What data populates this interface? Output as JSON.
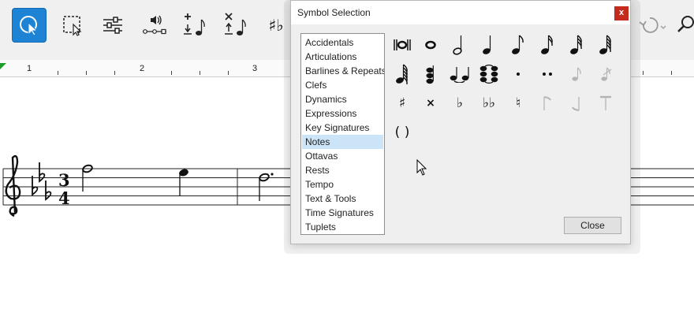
{
  "dialog": {
    "title": "Symbol Selection",
    "close_x": "x",
    "close_label": "Close",
    "selected_category": "Notes",
    "categories": [
      "Accidentals",
      "Articulations",
      "Barlines & Repeats",
      "Clefs",
      "Dynamics",
      "Expressions",
      "Key Signatures",
      "Notes",
      "Ottavas",
      "Rests",
      "Tempo",
      "Text & Tools",
      "Time Signatures",
      "Tuplets"
    ],
    "symbols": [
      {
        "name": "breve",
        "enabled": true
      },
      {
        "name": "whole-note",
        "enabled": true
      },
      {
        "name": "half-note",
        "enabled": true
      },
      {
        "name": "quarter-note",
        "enabled": true
      },
      {
        "name": "eighth-note",
        "enabled": true
      },
      {
        "name": "sixteenth-note",
        "enabled": true
      },
      {
        "name": "thirty-second-note",
        "enabled": true
      },
      {
        "name": "sixty-fourth-note",
        "enabled": true
      },
      {
        "name": "hundred-twenty-eighth-note",
        "enabled": true
      },
      {
        "name": "chord-notes",
        "enabled": true
      },
      {
        "name": "tie",
        "enabled": true
      },
      {
        "name": "tied-chord",
        "enabled": true
      },
      {
        "name": "dot",
        "enabled": true
      },
      {
        "name": "double-dot",
        "enabled": true
      },
      {
        "name": "grace-note",
        "enabled": false
      },
      {
        "name": "grace-note-slash",
        "enabled": false
      },
      {
        "name": "sharp",
        "enabled": true,
        "glyph": "♯"
      },
      {
        "name": "double-sharp",
        "enabled": true,
        "glyph": "×"
      },
      {
        "name": "flat",
        "enabled": true,
        "glyph": "♭"
      },
      {
        "name": "double-flat",
        "enabled": true,
        "glyph": "♭♭"
      },
      {
        "name": "natural",
        "enabled": true,
        "glyph": "♮"
      },
      {
        "name": "flag-up",
        "enabled": false
      },
      {
        "name": "flag-down",
        "enabled": false
      },
      {
        "name": "beam-flag",
        "enabled": false
      },
      {
        "name": "parentheses",
        "enabled": true,
        "glyph": "( )"
      }
    ]
  },
  "ruler": {
    "labels": [
      "1",
      "2",
      "3"
    ]
  },
  "toolbar": {
    "tools": [
      "select-tool",
      "marquee-select-tool",
      "properties-tool",
      "playback-tool",
      "add-note-tool",
      "delete-note-tool",
      "accidental-tool",
      "redo-tool",
      "search-tool"
    ]
  },
  "score": {
    "time_signature_top": "3",
    "time_signature_bottom": "4"
  },
  "colors": {
    "accent": "#1d83d4",
    "selected_row": "#cce4f7",
    "close_red": "#c42b1c"
  }
}
